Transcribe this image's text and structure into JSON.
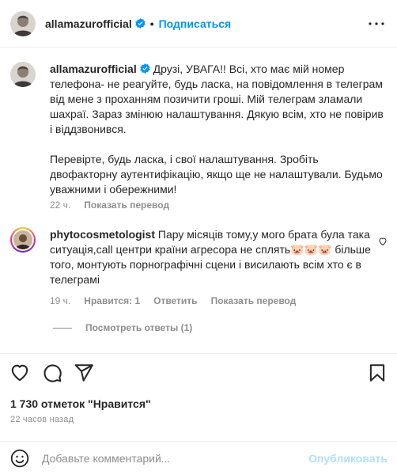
{
  "header": {
    "username": "allamazurofficial",
    "separator": "•",
    "follow_label": "Подписаться"
  },
  "caption": {
    "username": "allamazurofficial",
    "text_part1": "Друзі, УВАГА!! Всі, хто має мій номер телефона- не реагуйте, будь ласка, на повідомлення в телеграм від мене з проханням позичити гроші. Мій телеграм зламали шахраї. Зараз змінюю налаштування. Дякую всім, хто не повірив і віддзвонився.",
    "text_part2": "Перевірте, будь ласка, і свої налаштування. Зробіть двофакторну аутентифікацію, якщо ще не налаштували. Будьмо уважними і обережними!",
    "time": "22 ч.",
    "translate_label": "Показать перевод"
  },
  "comment": {
    "username": "phytocosmetologist",
    "text": "Пару місяців тому,у мого брата була така ситуація,call центри країни агресора не сплять🐷🐷🐷 більше того, монтують порнографічні сцени і висилають всім хто є в телеграмі",
    "time": "19 ч.",
    "likes_label": "Нравится: 1",
    "reply_label": "Ответить",
    "translate_label": "Показать перевод",
    "view_replies_label": "Посмотреть ответы (1)"
  },
  "stats": {
    "likes_text": "1 730 отметок \"Нравится\"",
    "time_ago": "22 часов назад"
  },
  "add_comment": {
    "placeholder": "Добавьте комментарий...",
    "publish_label": "Опубликовать"
  },
  "icons": {
    "header_avatar": "user-avatar-icon",
    "verified": "verified-badge-icon",
    "more": "more-horizontal-icon",
    "comment_like": "heart-outline-icon",
    "like": "heart-icon",
    "comment": "comment-bubble-icon",
    "share": "paper-plane-icon",
    "save": "bookmark-icon",
    "emoji": "emoji-smile-icon"
  },
  "colors": {
    "accent": "#0095f6",
    "publish_disabled": "#b2dffc",
    "secondary_text": "#8e8e8e",
    "primary_text": "#262626"
  }
}
